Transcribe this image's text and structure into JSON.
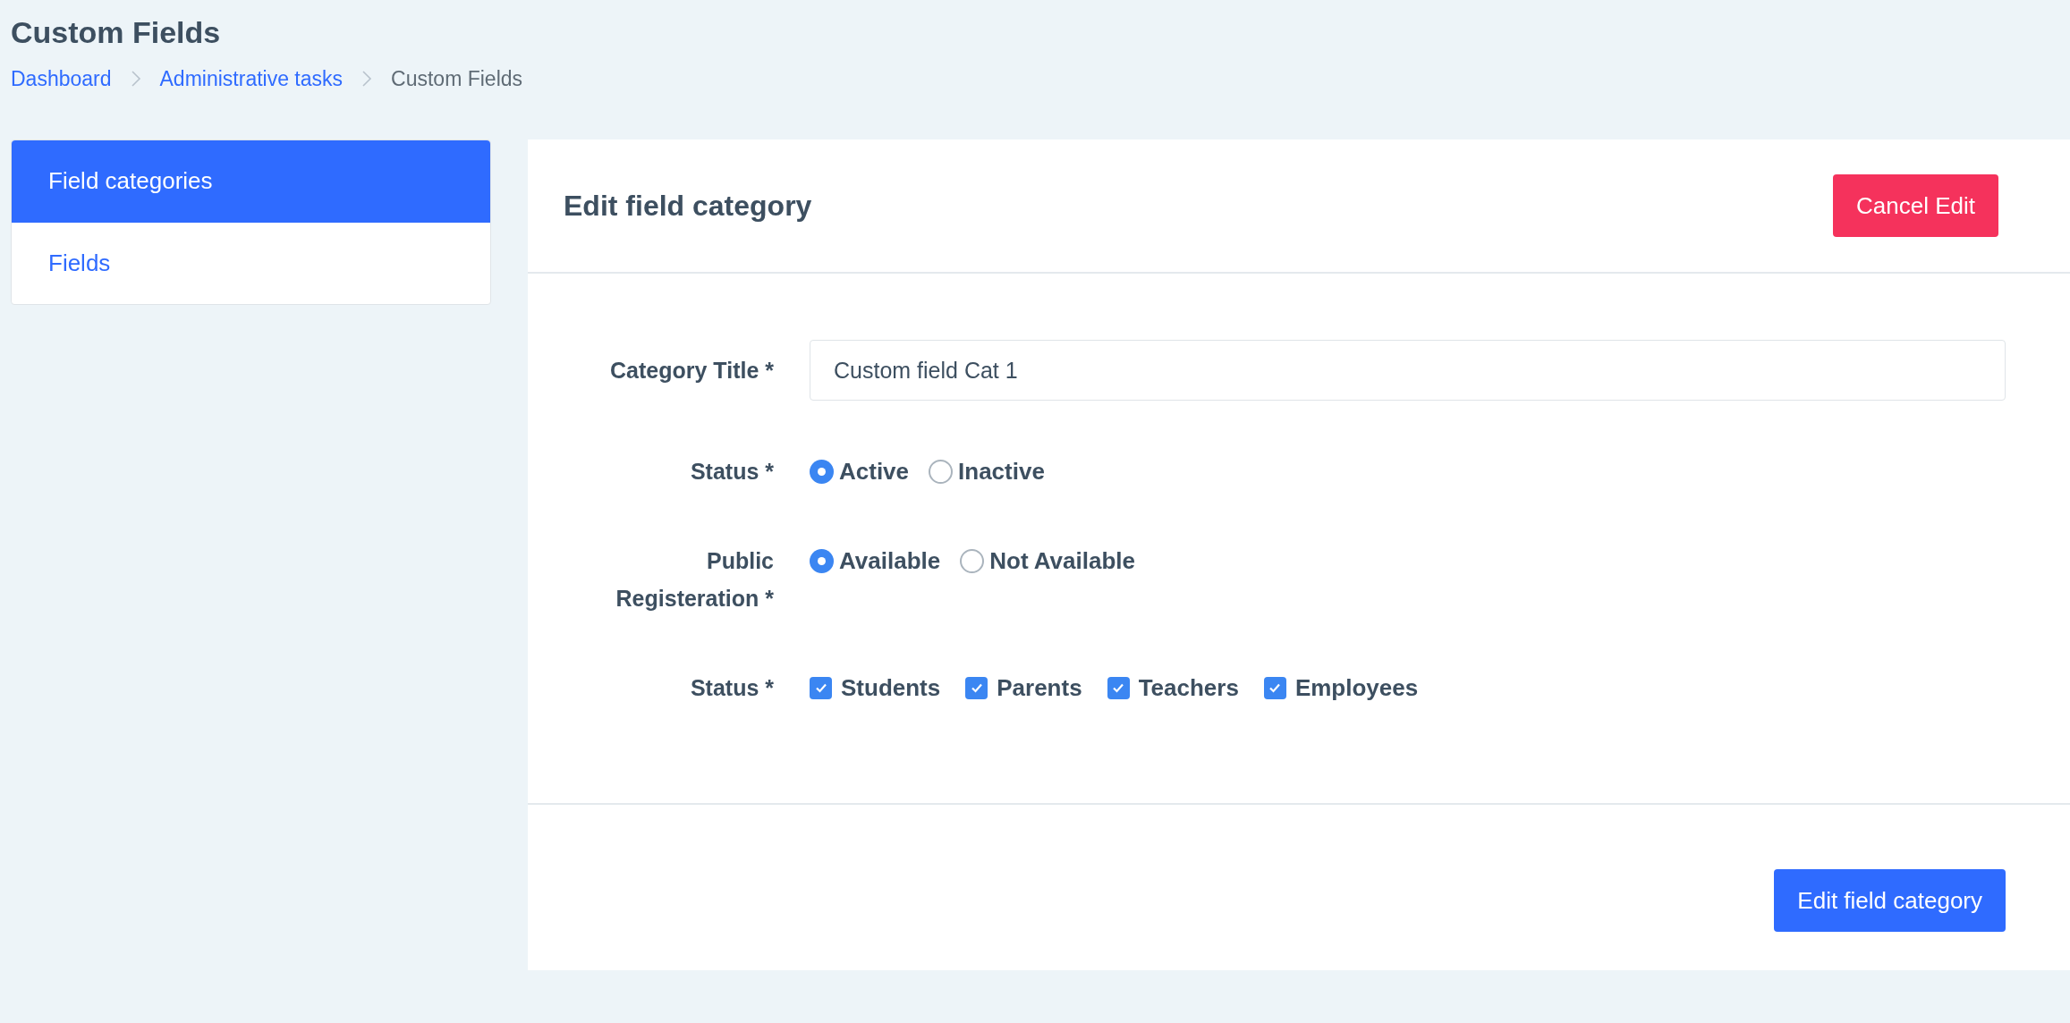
{
  "page": {
    "title": "Custom Fields"
  },
  "breadcrumbs": [
    {
      "label": "Dashboard",
      "kind": "link"
    },
    {
      "label": "Administrative tasks",
      "kind": "link"
    },
    {
      "label": "Custom Fields",
      "kind": "current"
    }
  ],
  "sidebar": {
    "items": [
      {
        "label": "Field categories",
        "selected": true
      },
      {
        "label": "Fields",
        "selected": false
      }
    ]
  },
  "panel": {
    "title": "Edit field category",
    "cancel_button": "Cancel Edit",
    "submit_button": "Edit field category"
  },
  "form": [
    {
      "kind": "text",
      "label": "Category Title *",
      "value": "Custom field Cat 1"
    },
    {
      "kind": "radio",
      "label": "Status *",
      "options": [
        {
          "label": "Active",
          "selected": true
        },
        {
          "label": "Inactive",
          "selected": false
        }
      ]
    },
    {
      "kind": "radio",
      "label": "Public Registeration *",
      "options": [
        {
          "label": "Available",
          "selected": true
        },
        {
          "label": "Not Available",
          "selected": false
        }
      ]
    },
    {
      "kind": "checkbox",
      "label": "Status *",
      "options": [
        {
          "label": "Students",
          "checked": true
        },
        {
          "label": "Parents",
          "checked": true
        },
        {
          "label": "Teachers",
          "checked": true
        },
        {
          "label": "Employees",
          "checked": true
        }
      ]
    }
  ]
}
